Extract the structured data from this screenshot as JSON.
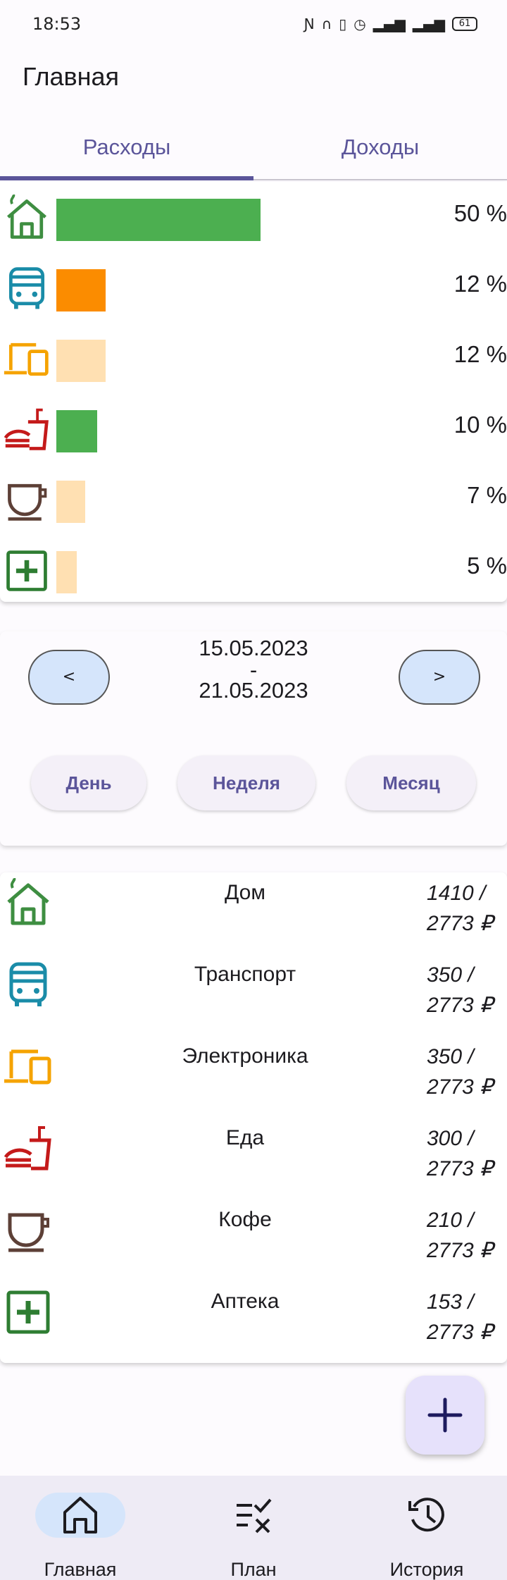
{
  "status_bar": {
    "time": "18:53",
    "indicators": [
      "nfc-icon",
      "headphones-icon",
      "vibrate-icon",
      "alarm-icon",
      "signal-4g-icon",
      "signal-icon"
    ],
    "battery": "61"
  },
  "app_title": "Главная",
  "tabs": [
    {
      "label": "Расходы",
      "active": true
    },
    {
      "label": "Доходы",
      "active": false
    }
  ],
  "breakdown": [
    {
      "category": "Дом",
      "icon": "house-icon",
      "percent_label": "50 %",
      "share": 0.5,
      "bar_color": "#4caf50"
    },
    {
      "category": "Транспорт",
      "icon": "bus-icon",
      "percent_label": "12 %",
      "share": 0.12,
      "bar_color": "#fb8c00"
    },
    {
      "category": "Электроника",
      "icon": "devices-icon",
      "percent_label": "12 %",
      "share": 0.12,
      "bar_color": "#ffe0b2"
    },
    {
      "category": "Еда",
      "icon": "fastfood-icon",
      "percent_label": "10 %",
      "share": 0.1,
      "bar_color": "#4caf50"
    },
    {
      "category": "Кофе",
      "icon": "coffee-icon",
      "percent_label": "7 %",
      "share": 0.07,
      "bar_color": "#ffe0b2"
    },
    {
      "category": "Аптека",
      "icon": "pharmacy-icon",
      "percent_label": "5 %",
      "share": 0.05,
      "bar_color": "#ffe0b2"
    }
  ],
  "period": {
    "prev_label": "<",
    "next_label": ">",
    "start": "15.05.2023",
    "separator": "-",
    "end": "21.05.2023",
    "buttons": [
      "День",
      "Неделя",
      "Месяц"
    ]
  },
  "expenses": [
    {
      "name": "Дом",
      "icon": "house-icon",
      "amount": "1410 /",
      "total": "2773 ₽"
    },
    {
      "name": "Транспорт",
      "icon": "bus-icon",
      "amount": "350 /",
      "total": "2773 ₽"
    },
    {
      "name": "Электроника",
      "icon": "devices-icon",
      "amount": "350 /",
      "total": "2773 ₽"
    },
    {
      "name": "Еда",
      "icon": "fastfood-icon",
      "amount": "300 /",
      "total": "2773 ₽"
    },
    {
      "name": "Кофе",
      "icon": "coffee-icon",
      "amount": "210 /",
      "total": "2773 ₽"
    },
    {
      "name": "Аптека",
      "icon": "pharmacy-icon",
      "amount": "153 /",
      "total": "2773 ₽"
    }
  ],
  "fab": {
    "icon": "plus-icon"
  },
  "bottom_nav": [
    {
      "label": "Главная",
      "icon": "home-icon",
      "active": true
    },
    {
      "label": "План",
      "icon": "checklist-icon",
      "active": false
    },
    {
      "label": "История",
      "icon": "history-icon",
      "active": false
    }
  ],
  "colors": {
    "accent": "#5b559a",
    "house": "#3e8e41",
    "bus": "#1a8ca8",
    "devices": "#f5a300",
    "food": "#c41a1a",
    "coffee": "#5d4037",
    "pharmacy": "#2e7d32"
  }
}
